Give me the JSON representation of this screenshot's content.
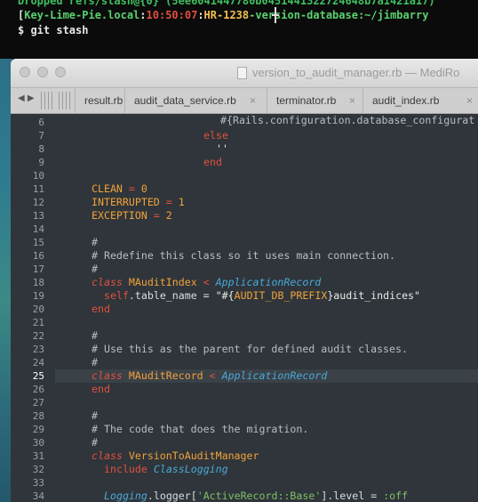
{
  "terminal": {
    "line1": "Dropped refs/stash@{0} (5ee6041447780b0451441322724648b7a1421a17)",
    "prompt_open": "[",
    "host": "Key-Lime-Pie.local",
    "sep1": ":",
    "time": "10:50:07",
    "sep2": ":",
    "branch": "HR-1238",
    "rest": "-version-database:~/jimbarry",
    "command": "$ git stash"
  },
  "window": {
    "title": "version_to_audit_manager.rb — MediRo"
  },
  "tabs": [
    {
      "label": "result.rb"
    },
    {
      "label": "audit_data_service.rb"
    },
    {
      "label": "terminator.rb"
    },
    {
      "label": "audit_index.rb"
    }
  ],
  "tab_close_glyph": "×",
  "editor": {
    "current_line": 25,
    "lines": [
      {
        "n": "6"
      },
      {
        "n": "7"
      },
      {
        "n": "8"
      },
      {
        "n": "9"
      },
      {
        "n": "10"
      },
      {
        "n": "11"
      },
      {
        "n": "12"
      },
      {
        "n": "13"
      },
      {
        "n": "14"
      },
      {
        "n": "15"
      },
      {
        "n": "16"
      },
      {
        "n": "17"
      },
      {
        "n": "18"
      },
      {
        "n": "19"
      },
      {
        "n": "20"
      },
      {
        "n": "21"
      },
      {
        "n": "22"
      },
      {
        "n": "23"
      },
      {
        "n": "24"
      },
      {
        "n": "25"
      },
      {
        "n": "26"
      },
      {
        "n": "27"
      },
      {
        "n": "28"
      },
      {
        "n": "29"
      },
      {
        "n": "30"
      },
      {
        "n": "31"
      },
      {
        "n": "32"
      },
      {
        "n": "33"
      },
      {
        "n": "34"
      }
    ],
    "code": {
      "l6": "#{Rails.configuration.database_configurat",
      "l7": "else",
      "l8": "''",
      "l9": "end",
      "l11_name": "CLEAN",
      "l11_val": "0",
      "l12_name": "INTERRUPTED",
      "l12_val": "1",
      "l13_name": "EXCEPTION",
      "l13_val": "2",
      "l15": "#",
      "l16": "# Redefine this class so it uses main connection.",
      "l17": "#",
      "l18_kw": "class",
      "l18_name": "MAuditIndex",
      "l18_lt": "<",
      "l18_parent": "ApplicationRecord",
      "l19_self": "self",
      "l19_attr": ".table_name = ",
      "l19_str1": "\"#{",
      "l19_const": "AUDIT_DB_PREFIX",
      "l19_str2": "}audit_indices\"",
      "l20": "end",
      "l22": "#",
      "l23": "# Use this as the parent for defined audit classes.",
      "l24": "#",
      "l25_kw": "class",
      "l25_name": "MAuditRecord",
      "l25_lt": "<",
      "l25_parent": "ApplicationRecord",
      "l26": "end",
      "l28": "#",
      "l29": "# The code that does the migration.",
      "l30": "#",
      "l31_kw": "class",
      "l31_name": "VersionToAuditManager",
      "l32_kw": "include",
      "l32_mod": "ClassLogging",
      "l34_recv": "Logging",
      "l34_mid": ".logger[",
      "l34_str": "'ActiveRecord::Base'",
      "l34_end": "].level = ",
      "l34_sym": ":off"
    }
  }
}
